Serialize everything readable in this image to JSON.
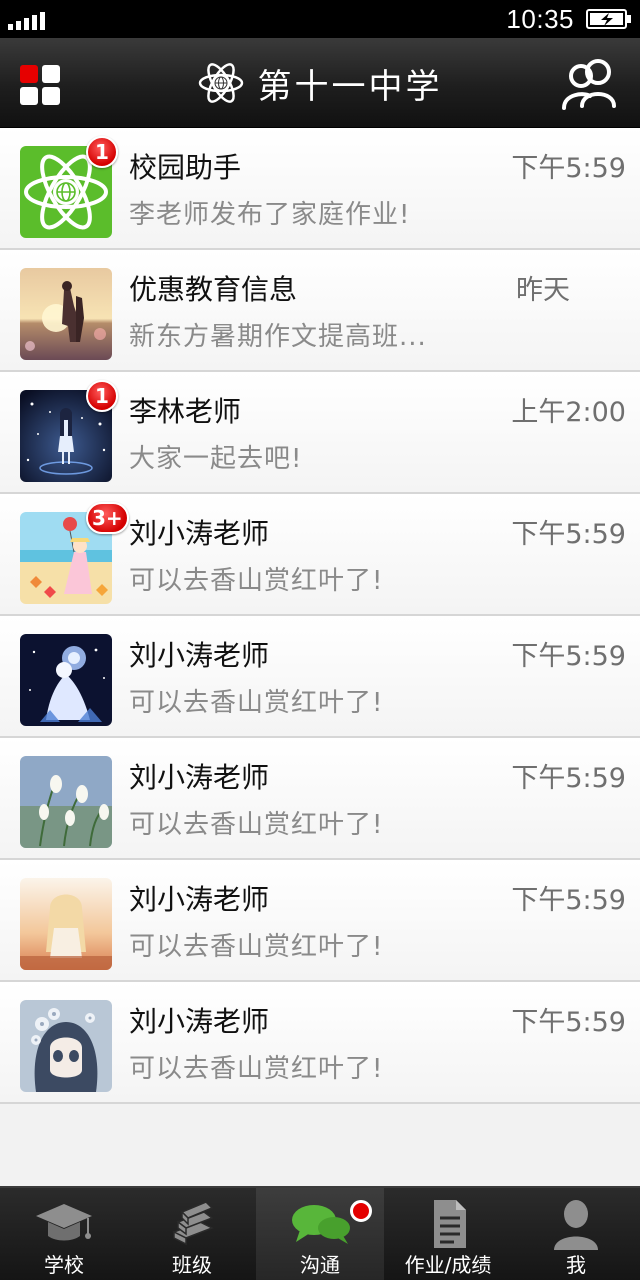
{
  "status_bar": {
    "time": "10:35"
  },
  "header": {
    "title": "第十一中学"
  },
  "messages": [
    {
      "name": "校园助手",
      "preview": "李老师发布了家庭作业!",
      "time": "下午5:59",
      "badge": "1",
      "avatar_icon": "campus-assistant-icon"
    },
    {
      "name": "优惠教育信息",
      "preview": "新东方暑期作文提高班...",
      "time": "昨天",
      "badge": "",
      "avatar_icon": "couple-sunset-avatar"
    },
    {
      "name": "李林老师",
      "preview": "大家一起去吧!",
      "time": "上午2:00",
      "badge": "1",
      "avatar_icon": "night-girl-avatar"
    },
    {
      "name": "刘小涛老师",
      "preview": "可以去香山赏红叶了!",
      "time": "下午5:59",
      "badge": "3+",
      "avatar_icon": "beach-girl-avatar"
    },
    {
      "name": "刘小涛老师",
      "preview": "可以去香山赏红叶了!",
      "time": "下午5:59",
      "badge": "",
      "avatar_icon": "flower-fairy-avatar"
    },
    {
      "name": "刘小涛老师",
      "preview": "可以去香山赏红叶了!",
      "time": "下午5:59",
      "badge": "",
      "avatar_icon": "snowdrop-flowers-avatar"
    },
    {
      "name": "刘小涛老师",
      "preview": "可以去香山赏红叶了!",
      "time": "下午5:59",
      "badge": "",
      "avatar_icon": "blonde-girl-avatar"
    },
    {
      "name": "刘小涛老师",
      "preview": "可以去香山赏红叶了!",
      "time": "下午5:59",
      "badge": "",
      "avatar_icon": "anime-girl-flowers-avatar"
    }
  ],
  "tabs": [
    {
      "label": "学校",
      "icon": "graduation-cap-icon",
      "active": false
    },
    {
      "label": "班级",
      "icon": "books-icon",
      "active": false
    },
    {
      "label": "沟通",
      "icon": "chat-bubbles-icon",
      "active": true
    },
    {
      "label": "作业/成绩",
      "icon": "document-icon",
      "active": false
    },
    {
      "label": "我",
      "icon": "person-icon",
      "active": false
    }
  ],
  "colors": {
    "badge": "#d40000",
    "assistant_green": "#5bbd2b",
    "header_dark": "#1e1e1e"
  }
}
